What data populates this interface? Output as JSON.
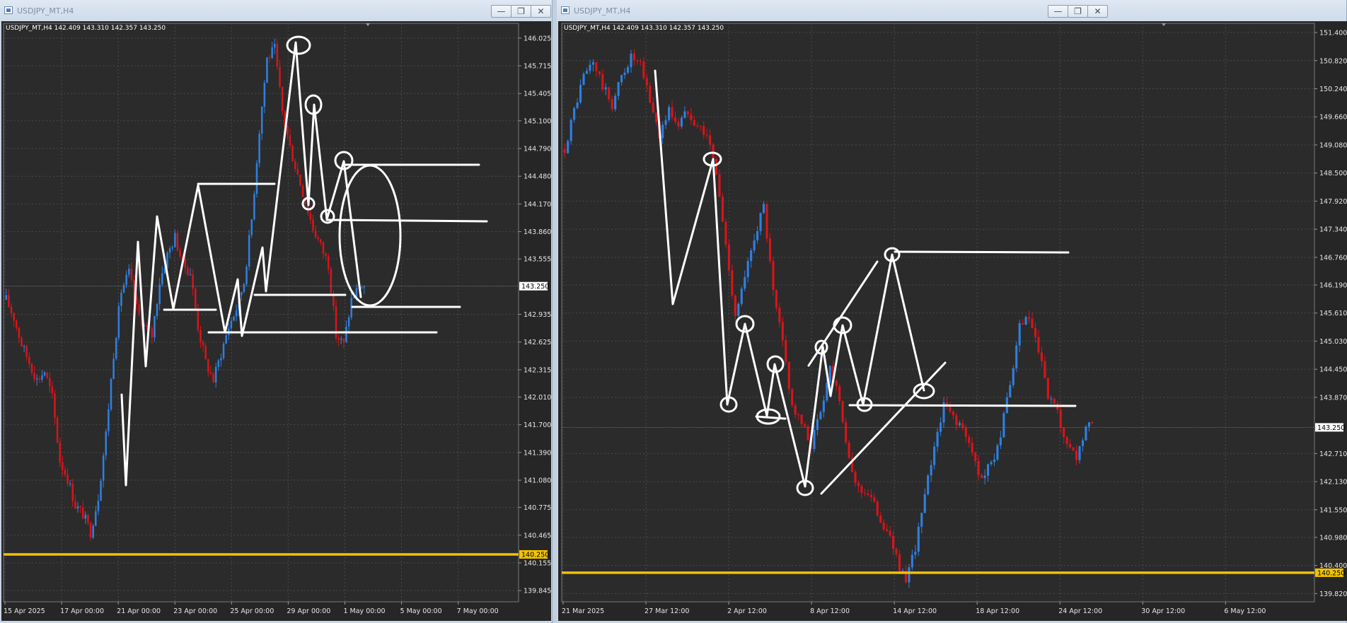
{
  "windows": [
    {
      "title": "USDJPY_MT,H4",
      "buttons": [
        "—",
        "❐",
        "✕"
      ],
      "info": "USDJPY_MT,H4  142.409 143.310 142.357 143.250"
    },
    {
      "title": "USDJPY_MT,H4",
      "buttons": [
        "—",
        "❐",
        "✕"
      ],
      "info": "USDJPY_MT,H4  142.409 143.310 142.357 143.250"
    }
  ],
  "colors": {
    "background": "#2b2b2b",
    "grid": "#4a4a4a",
    "bull": "#2f7fe0",
    "bear": "#d8141b",
    "level": "#f2c200",
    "drawing": "#ffffff",
    "axis_text": "#e6e6e6"
  },
  "chart_data": [
    {
      "type": "candlestick",
      "symbol": "USDJPY_MT",
      "timeframe": "H4",
      "price_ticks": [
        "146.025",
        "145.715",
        "145.405",
        "145.100",
        "144.790",
        "144.480",
        "144.170",
        "143.860",
        "143.555",
        "142.935",
        "142.625",
        "142.315",
        "142.010",
        "141.700",
        "141.390",
        "141.080",
        "140.775",
        "140.465",
        "140.155",
        "139.845"
      ],
      "ylim": [
        139.72,
        146.19
      ],
      "time_ticks": [
        "15 Apr 2025",
        "17 Apr 00:00",
        "21 Apr 00:00",
        "23 Apr 00:00",
        "25 Apr 00:00",
        "29 Apr 00:00",
        "1 May 00:00",
        "5 May 00:00",
        "7 May 00:00"
      ],
      "current_price": "143.250",
      "level_price": "140.250",
      "close_path": [
        143.1,
        142.9,
        142.6,
        142.4,
        142.2,
        142.3,
        142.0,
        141.3,
        141.1,
        140.8,
        140.7,
        140.5,
        140.9,
        141.6,
        142.5,
        143.2,
        143.4,
        143.0,
        142.8,
        142.7,
        143.3,
        143.6,
        143.8,
        143.5,
        143.4,
        142.8,
        142.4,
        142.2,
        142.5,
        142.8,
        143.0,
        143.3,
        144.0,
        145.0,
        145.8,
        145.9,
        145.2,
        144.8,
        144.5,
        144.2,
        143.9,
        143.7,
        143.5,
        142.7,
        142.6,
        143.1,
        143.25
      ]
    },
    {
      "type": "candlestick",
      "symbol": "USDJPY_MT",
      "timeframe": "H4",
      "price_ticks": [
        "151.400",
        "150.820",
        "150.240",
        "149.660",
        "149.080",
        "148.500",
        "147.920",
        "147.340",
        "146.760",
        "146.190",
        "145.610",
        "145.030",
        "144.450",
        "143.870",
        "142.710",
        "142.130",
        "141.550",
        "140.980",
        "140.400",
        "139.820"
      ],
      "ylim": [
        139.65,
        151.59
      ],
      "time_ticks": [
        "21 Mar 2025",
        "27 Mar 12:00",
        "2 Apr 12:00",
        "8 Apr 12:00",
        "14 Apr 12:00",
        "18 Apr 12:00",
        "24 Apr 12:00",
        "30 Apr 12:00",
        "6 May 12:00"
      ],
      "current_price": "143.250",
      "level_price": "140.250",
      "close_path": [
        149.0,
        149.8,
        150.5,
        150.8,
        150.3,
        149.9,
        150.5,
        150.9,
        150.7,
        150.0,
        149.3,
        149.8,
        149.5,
        149.8,
        149.5,
        149.3,
        148.5,
        147.0,
        145.6,
        146.3,
        147.2,
        147.8,
        146.0,
        145.0,
        143.7,
        143.3,
        142.9,
        143.6,
        144.5,
        143.9,
        142.5,
        142.0,
        141.9,
        141.5,
        141.1,
        140.6,
        140.0,
        140.8,
        141.8,
        142.9,
        143.7,
        143.5,
        143.2,
        142.7,
        142.2,
        142.5,
        143.1,
        144.1,
        145.3,
        145.5,
        144.8,
        143.9,
        143.5,
        142.8,
        142.6,
        143.25
      ]
    }
  ]
}
